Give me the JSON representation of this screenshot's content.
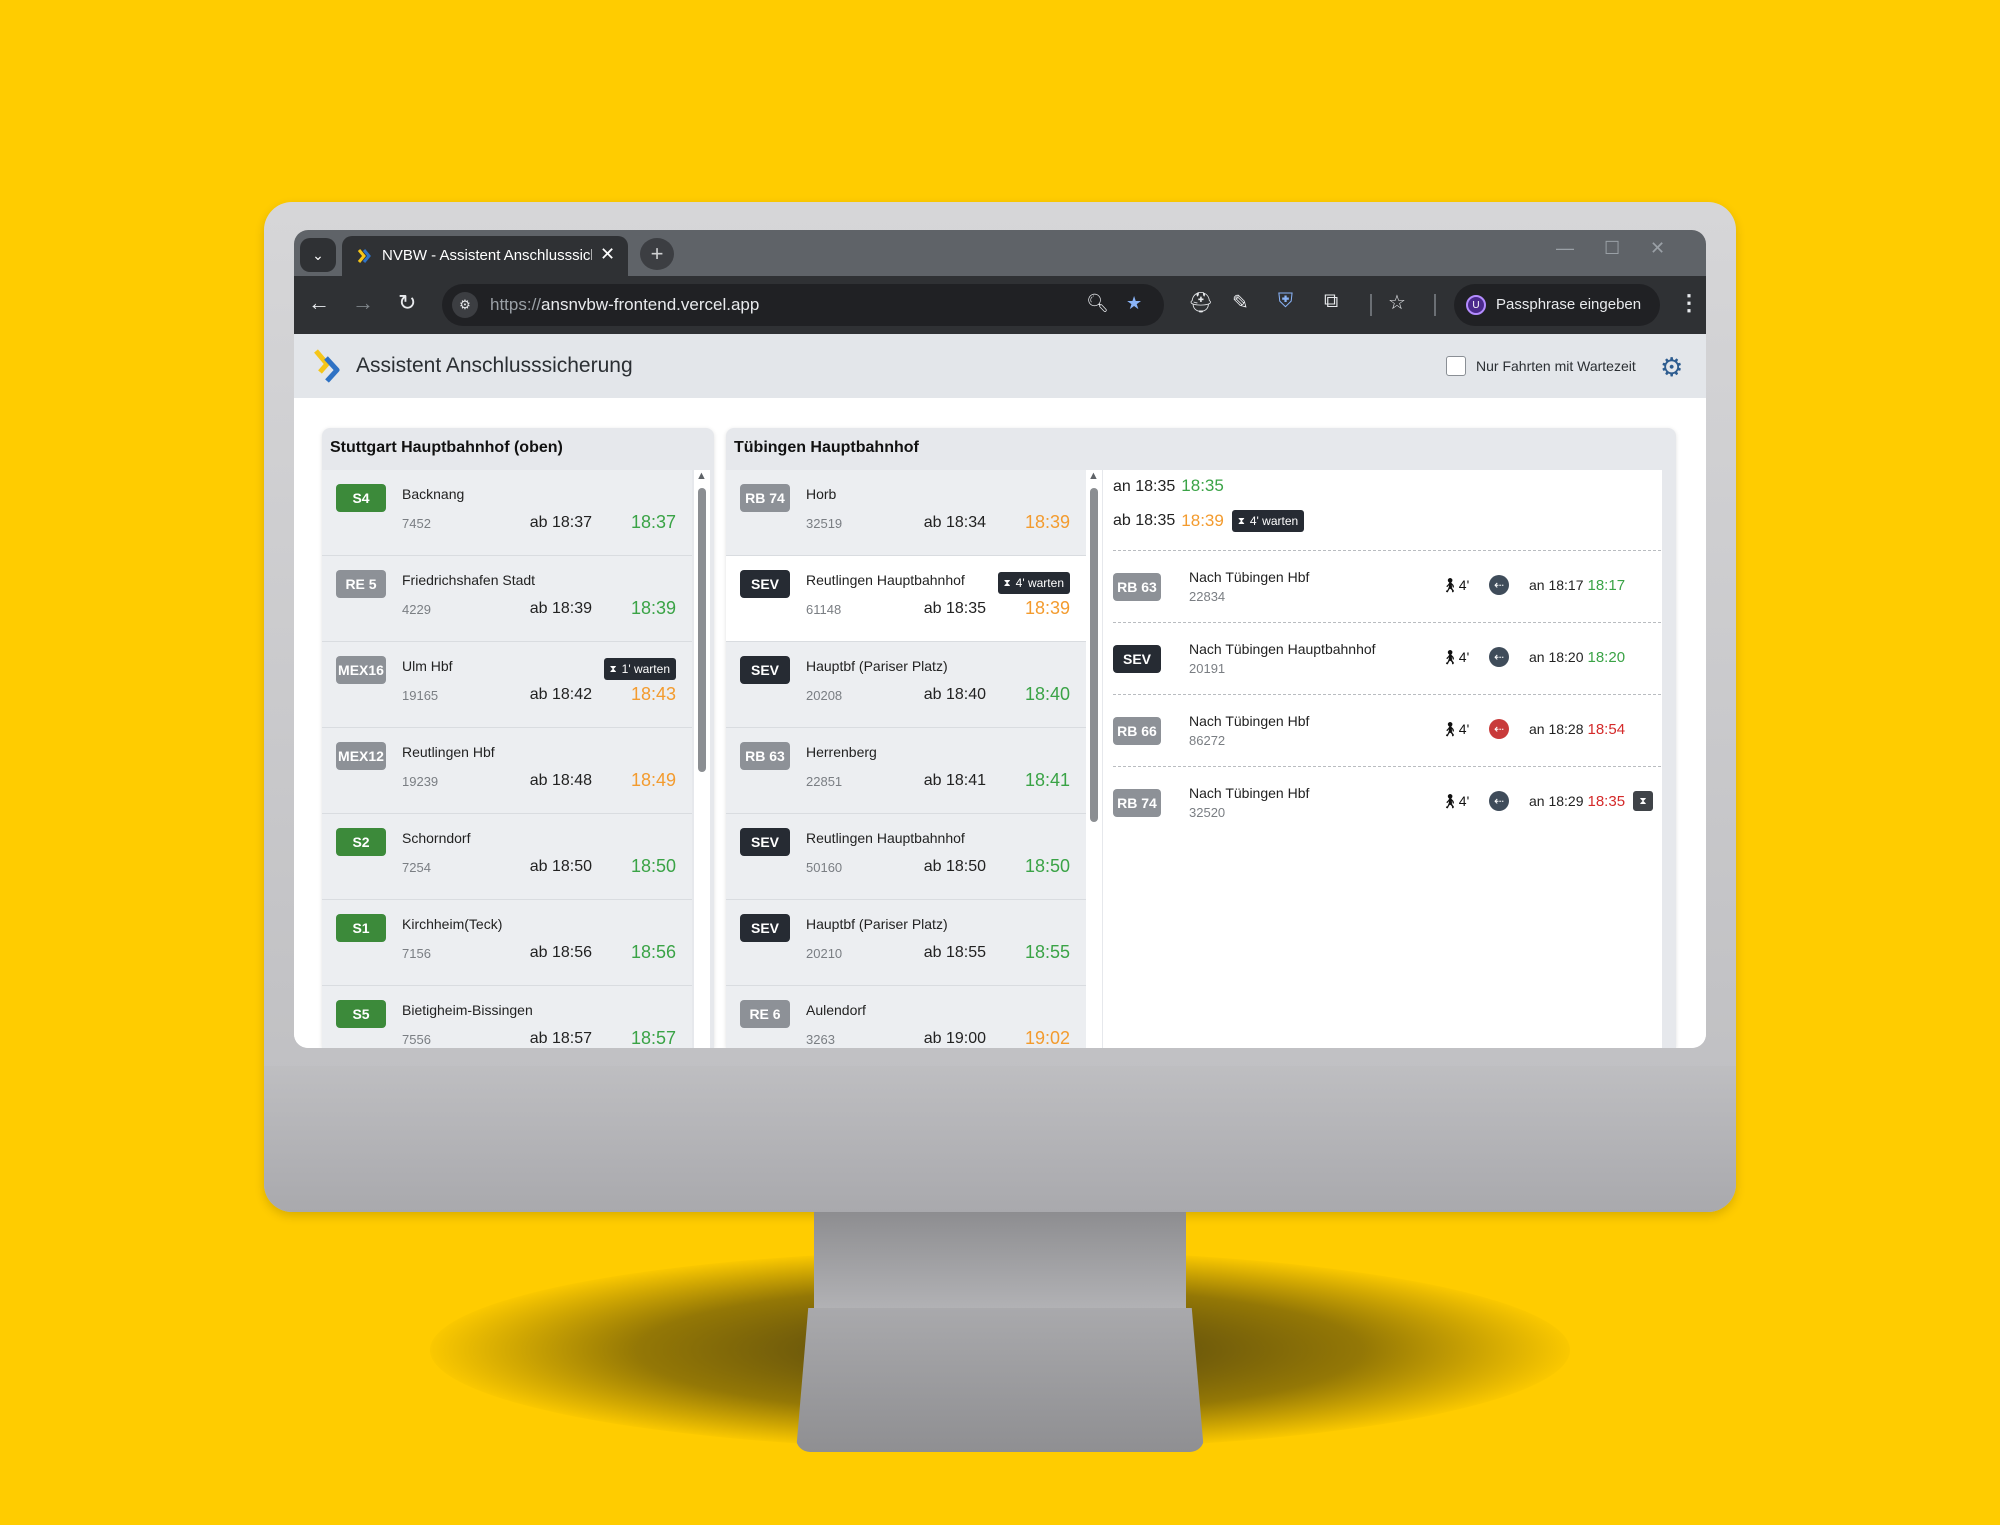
{
  "browser": {
    "tab_title": "NVBW - Assistent Anschlusssicherung",
    "new_tab": "+",
    "tab_close": "✕",
    "tab_list": "⌄",
    "url_prefix": "https://",
    "url_host": "ansnvbw-frontend.vercel.app",
    "profile_label": "Passphrase eingeben",
    "profile_initial": "U",
    "window_controls": [
      "—",
      "☐",
      "✕"
    ],
    "icons": [
      "back-arrow-icon",
      "forward-arrow-icon",
      "reload-icon",
      "site-info-icon",
      "zoom-icon",
      "bookmark-star-icon",
      "extension-icons",
      "menu-icon"
    ]
  },
  "app": {
    "title": "Assistent Anschlusssicherung",
    "filter_label": "Nur Fahrten mit Wartezeit",
    "filter_checked": false,
    "accent": "#2d5c8f"
  },
  "stuttgart": {
    "title": "Stuttgart Hauptbahnhof (oben)",
    "trains": [
      {
        "line": "S4",
        "badge": "green",
        "dest": "Backnang",
        "num": "7452",
        "sched": "ab 18:37",
        "real": "18:37",
        "status": "green"
      },
      {
        "line": "RE 5",
        "badge": "grey",
        "dest": "Friedrichshafen Stadt",
        "num": "4229",
        "sched": "ab 18:39",
        "real": "18:39",
        "status": "green"
      },
      {
        "line": "MEX16",
        "badge": "grey",
        "dest": "Ulm Hbf",
        "num": "19165",
        "sched": "ab 18:42",
        "real": "18:43",
        "status": "orange",
        "wait": "1' warten"
      },
      {
        "line": "MEX12",
        "badge": "grey",
        "dest": "Reutlingen Hbf",
        "num": "19239",
        "sched": "ab 18:48",
        "real": "18:49",
        "status": "orange"
      },
      {
        "line": "S2",
        "badge": "green",
        "dest": "Schorndorf",
        "num": "7254",
        "sched": "ab 18:50",
        "real": "18:50",
        "status": "green"
      },
      {
        "line": "S1",
        "badge": "green",
        "dest": "Kirchheim(Teck)",
        "num": "7156",
        "sched": "ab 18:56",
        "real": "18:56",
        "status": "green"
      },
      {
        "line": "S5",
        "badge": "green",
        "dest": "Bietigheim-Bissingen",
        "num": "7556",
        "sched": "ab 18:57",
        "real": "18:57",
        "status": "green"
      }
    ]
  },
  "tuebingen": {
    "title": "Tübingen Hauptbahnhof",
    "trains": [
      {
        "line": "RB 74",
        "badge": "grey",
        "dest": "Horb",
        "num": "32519",
        "sched": "ab 18:34",
        "real": "18:39",
        "status": "orange"
      },
      {
        "line": "SEV",
        "badge": "dark",
        "dest": "Reutlingen Hauptbahnhof",
        "num": "61148",
        "sched": "ab 18:35",
        "real": "18:39",
        "status": "orange",
        "wait": "4' warten",
        "selected": true
      },
      {
        "line": "SEV",
        "badge": "dark",
        "dest": "Hauptbf (Pariser Platz)",
        "num": "20208",
        "sched": "ab 18:40",
        "real": "18:40",
        "status": "green"
      },
      {
        "line": "RB 63",
        "badge": "grey",
        "dest": "Herrenberg",
        "num": "22851",
        "sched": "ab 18:41",
        "real": "18:41",
        "status": "green"
      },
      {
        "line": "SEV",
        "badge": "dark",
        "dest": "Reutlingen Hauptbahnhof",
        "num": "50160",
        "sched": "ab 18:50",
        "real": "18:50",
        "status": "green"
      },
      {
        "line": "SEV",
        "badge": "dark",
        "dest": "Hauptbf (Pariser Platz)",
        "num": "20210",
        "sched": "ab 18:55",
        "real": "18:55",
        "status": "green"
      },
      {
        "line": "RE 6",
        "badge": "grey",
        "dest": "Aulendorf",
        "num": "3263",
        "sched": "ab 19:00",
        "real": "19:02",
        "status": "orange"
      }
    ]
  },
  "detail": {
    "arrival_sched": "an 18:35",
    "arrival_real": "18:35",
    "departure_sched": "ab 18:35",
    "departure_real": "18:39",
    "wait": "4' warten",
    "connections": [
      {
        "line": "RB 63",
        "badge": "grey",
        "dest": "Nach Tübingen Hbf",
        "num": "22834",
        "walk": "4'",
        "icon": "connection-ok-icon",
        "sched": "an 18:17",
        "real": "18:17",
        "status": "green"
      },
      {
        "line": "SEV",
        "badge": "dark",
        "dest": "Nach Tübingen Hauptbahnhof",
        "num": "20191",
        "walk": "4'",
        "icon": "connection-ok-icon",
        "sched": "an 18:20",
        "real": "18:20",
        "status": "green"
      },
      {
        "line": "RB 66",
        "badge": "grey",
        "dest": "Nach Tübingen Hbf",
        "num": "86272",
        "walk": "4'",
        "icon": "connection-alert-icon",
        "sched": "an 18:28",
        "real": "18:54",
        "status": "red"
      },
      {
        "line": "RB 74",
        "badge": "grey",
        "dest": "Nach Tübingen Hbf",
        "num": "32520",
        "walk": "4'",
        "icon": "connection-ok-icon",
        "sched": "an 18:29",
        "real": "18:35",
        "status": "red",
        "wait_icon": true
      }
    ]
  }
}
